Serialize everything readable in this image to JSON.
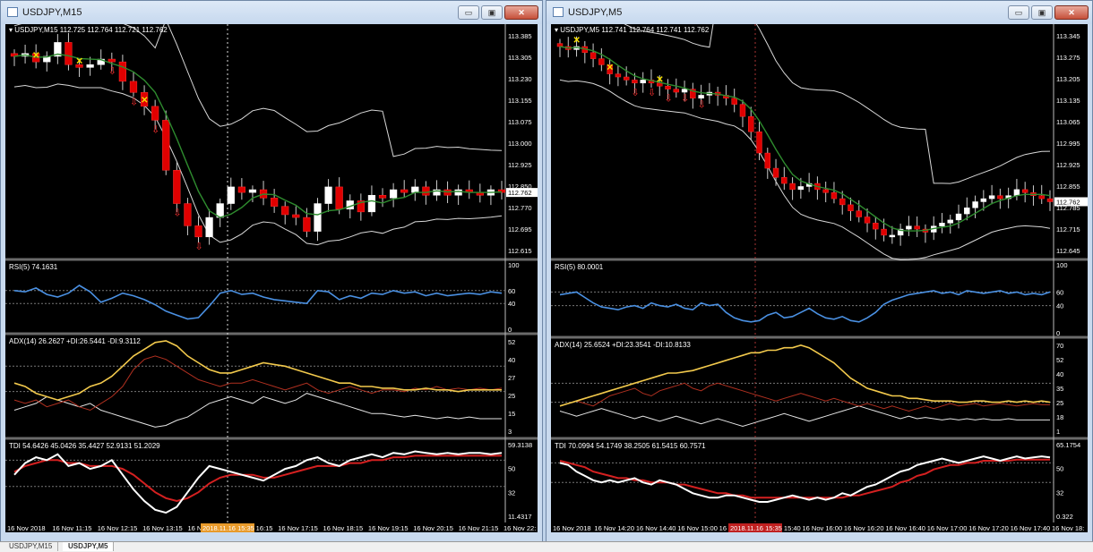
{
  "windows": [
    {
      "id": "left",
      "title": "USDJPY,M15",
      "buttons": {
        "minimize": "▭",
        "maximize": "▣",
        "close": "✕"
      },
      "price_label": "USDJPY,M15  112.725 112.764 112.721 112.762",
      "price_axis": [
        "113.385",
        "113.305",
        "113.230",
        "113.155",
        "113.075",
        "113.000",
        "112.925",
        "112.850",
        "112.770",
        "112.695",
        "112.615"
      ],
      "current_price": "112.762",
      "rsi_label": "RSI(5) 74.1631",
      "rsi_axis": [
        "100",
        "60",
        "40",
        "0"
      ],
      "adx_label": "ADX(14) 26.2627 +DI:26.5441 -DI:9.3112",
      "adx_axis": [
        "52",
        "40",
        "27",
        "25",
        "15",
        "3"
      ],
      "tdi_label": "TDI 54.6426 45.0426 35.4427 52.9131 51.2029",
      "tdi_axis": [
        "59.3138",
        "50",
        "32",
        "11.4317"
      ],
      "time_axis": [
        "16 Nov 2018",
        "16 Nov 11:15",
        "16 Nov 12:15",
        "16 Nov 13:15",
        "16 Nov 14",
        "16 Nov 16:15",
        "16 Nov 17:15",
        "16 Nov 18:15",
        "16 Nov 19:15",
        "16 Nov 20:15",
        "16 Nov 21:15",
        "16 Nov 22:"
      ],
      "cursor_time": "2018.11.16 15:35"
    },
    {
      "id": "right",
      "title": "USDJPY,M5",
      "buttons": {
        "minimize": "▭",
        "maximize": "▣",
        "close": "✕"
      },
      "price_label": "USDJPY,M5  112.741 112.764 112.741 112.762",
      "price_axis": [
        "113.345",
        "113.275",
        "113.205",
        "113.135",
        "113.065",
        "112.995",
        "112.925",
        "112.855",
        "112.785",
        "112.715",
        "112.645"
      ],
      "current_price": "112.762",
      "rsi_label": "RSI(5) 80.0001",
      "rsi_axis": [
        "100",
        "60",
        "40",
        "0"
      ],
      "adx_label": "ADX(14) 25.6524 +DI:23.3541 -DI:10.8133",
      "adx_axis": [
        "70",
        "52",
        "40",
        "35",
        "25",
        "18",
        "1"
      ],
      "tdi_label": "TDI 70.0994 54.1749 38.2505 61.5415 60.7571",
      "tdi_axis": [
        "65.1754",
        "50",
        "32",
        "0.322"
      ],
      "time_axis": [
        "16 Nov 2018",
        "16 Nov 14:20",
        "16 Nov 14:40",
        "16 Nov 15:00",
        "16 Nov 15",
        "16 Nov 15:40",
        "16 Nov 16:00",
        "16 Nov 16:20",
        "16 Nov 16:40",
        "16 Nov 17:00",
        "16 Nov 17:20",
        "16 Nov 17:40",
        "16 Nov 18:"
      ],
      "cursor_time": "2018.11.16 15:35"
    }
  ],
  "tabs": [
    "USDJPY,M15",
    "USDJPY,M5"
  ],
  "colors": {
    "bull": "#ffffff",
    "bear": "#e00000",
    "band": "#d8d8d8",
    "ma": "#2e8b2e",
    "rsi": "#4a90e2",
    "adx": "#f2c94c",
    "di_plus": "#b03020",
    "di_minus": "#e6e6e6",
    "tdi_fast": "#ffffff",
    "tdi_slow": "#d42020",
    "signal_x": "#f5e000"
  }
}
